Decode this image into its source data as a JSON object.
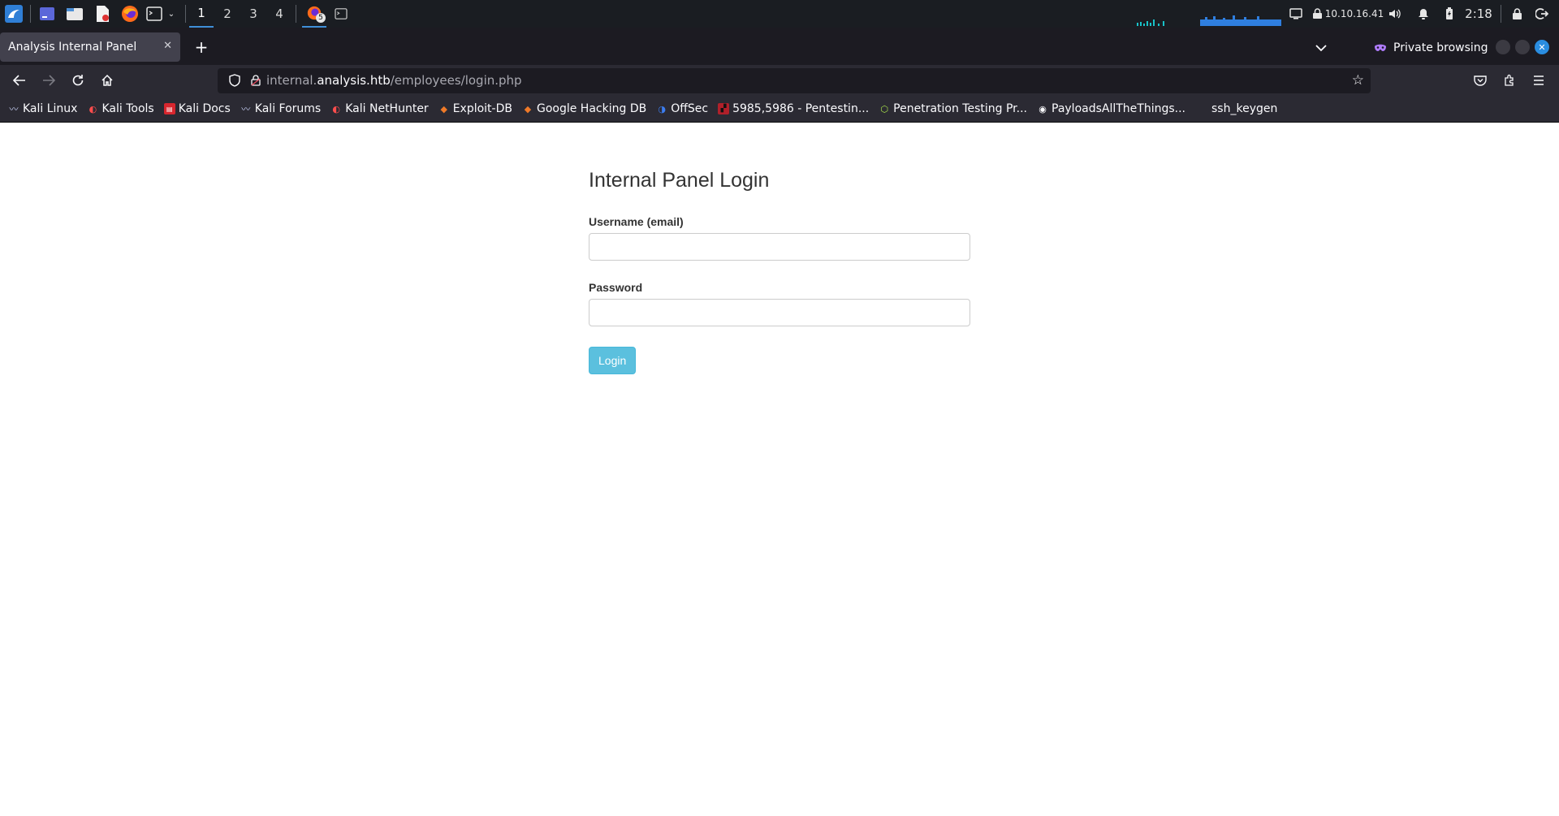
{
  "taskbar": {
    "workspaces": [
      "1",
      "2",
      "3",
      "4"
    ],
    "active_workspace": "1",
    "firefox_badge": "5",
    "ip_address": "10.10.16.41",
    "time": "2:18"
  },
  "browser": {
    "tab_title": "Analysis Internal Panel",
    "private_label": "Private browsing",
    "url": {
      "prefix": "internal.",
      "host": "analysis.htb",
      "path": "/employees/login.php"
    }
  },
  "bookmarks": [
    {
      "label": "Kali Linux",
      "icon": "kali-dragon-icon"
    },
    {
      "label": "Kali Tools",
      "icon": "kali-tools-icon"
    },
    {
      "label": "Kali Docs",
      "icon": "kali-docs-icon"
    },
    {
      "label": "Kali Forums",
      "icon": "kali-dragon-icon"
    },
    {
      "label": "Kali NetHunter",
      "icon": "nethunter-icon"
    },
    {
      "label": "Exploit-DB",
      "icon": "exploit-db-icon"
    },
    {
      "label": "Google Hacking DB",
      "icon": "ghdb-icon"
    },
    {
      "label": "OffSec",
      "icon": "offsec-icon"
    },
    {
      "label": "5985,5986 - Pentestin...",
      "icon": "hacktricks-icon"
    },
    {
      "label": "Penetration Testing Pr...",
      "icon": "cube-icon"
    },
    {
      "label": "PayloadsAllTheThings...",
      "icon": "github-icon"
    },
    {
      "label": "ssh_keygen",
      "icon": "none"
    }
  ],
  "login": {
    "title": "Internal Panel Login",
    "username_label": "Username (email)",
    "username_value": "",
    "password_label": "Password",
    "password_value": "",
    "submit_label": "Login"
  },
  "colors": {
    "taskbar_bg": "#1a1d22",
    "browser_chrome": "#2b2a33",
    "tab_active": "#42414d",
    "login_button": "#5bc0de",
    "accent_blue": "#2a8de0"
  }
}
